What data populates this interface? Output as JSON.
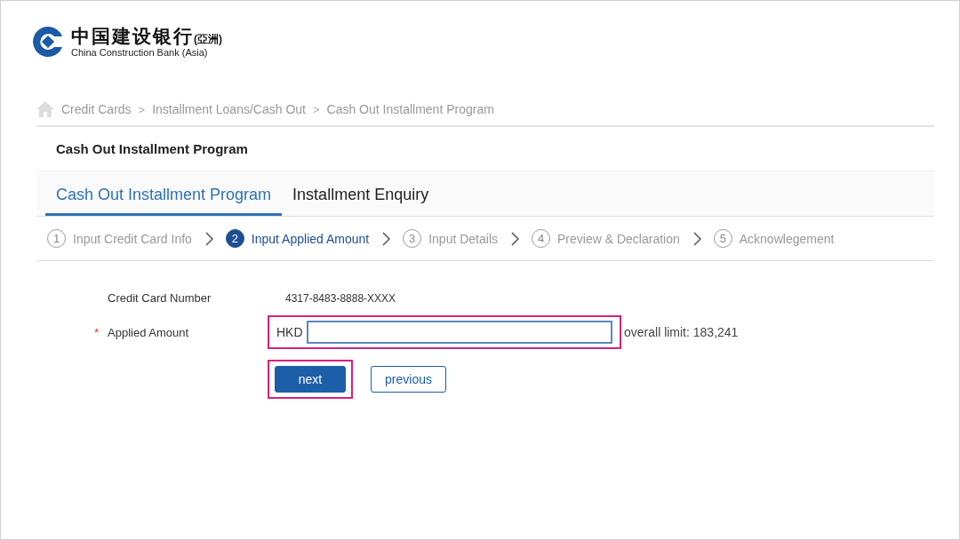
{
  "logo": {
    "name_cn": "中国建设银行",
    "region_cn": "(亞洲)",
    "name_en": "China Construction Bank (Asia)"
  },
  "breadcrumb": [
    "Credit Cards",
    "Installment Loans/Cash Out",
    "Cash Out Installment Program"
  ],
  "separator": ">",
  "page_title": "Cash Out Installment Program",
  "tabs": [
    {
      "label": "Cash Out Installment Program",
      "selected": true
    },
    {
      "label": "Installment Enquiry",
      "selected": false
    }
  ],
  "steps": [
    {
      "number": "1",
      "label": "Input Credit Card Info",
      "selected": false
    },
    {
      "number": "2",
      "label": "Input Applied Amount",
      "selected": true
    },
    {
      "number": "3",
      "label": "Input Details",
      "selected": false
    },
    {
      "number": "4",
      "label": "Preview & Declaration",
      "selected": false
    },
    {
      "number": "5",
      "label": "Acknowlegement",
      "selected": false
    }
  ],
  "form": {
    "card_label": "Credit Card Number",
    "card_value": "4317-8483-8888-XXXX",
    "required_mark": "*",
    "amount_label": "Applied Amount",
    "currency": "HKD",
    "limit": "overall limit: 183,241",
    "highlighted": true
  },
  "buttons": [
    {
      "label": "next",
      "kind": "primary",
      "highlighted": true
    },
    {
      "label": "previous",
      "kind": "secondary",
      "highlighted": false
    }
  ]
}
